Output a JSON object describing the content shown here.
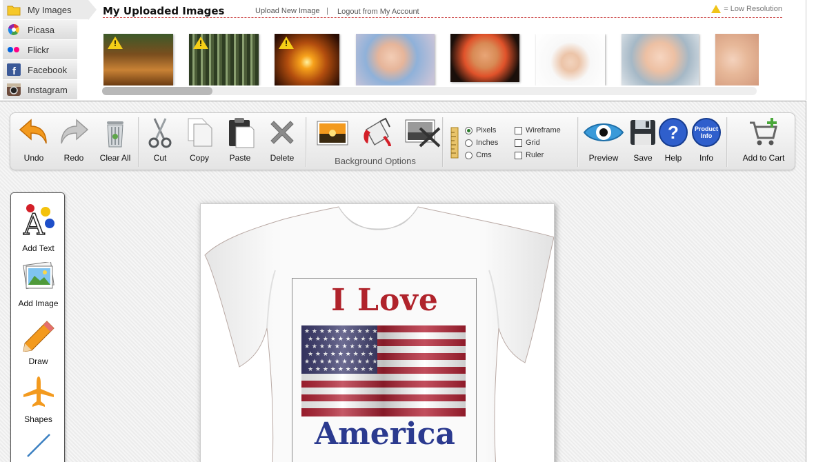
{
  "sources": [
    {
      "label": "My Images",
      "icon": "folder-icon",
      "active": true
    },
    {
      "label": "Picasa",
      "icon": "picasa-icon"
    },
    {
      "label": "Flickr",
      "icon": "flickr-icon"
    },
    {
      "label": "Facebook",
      "icon": "facebook-icon"
    },
    {
      "label": "Instagram",
      "icon": "instagram-icon"
    }
  ],
  "header": {
    "title": "My Uploaded Images",
    "upload_link": "Upload New Image",
    "separator": "|",
    "logout_link": "Logout from My Account",
    "low_res_legend": "= Low Resolution"
  },
  "thumbnails": [
    {
      "subject": "forest path",
      "low_res": true
    },
    {
      "subject": "bamboo path",
      "low_res": true
    },
    {
      "subject": "sunset pier",
      "low_res": true
    },
    {
      "subject": "laughing baby",
      "low_res": false
    },
    {
      "subject": "baby with glasses",
      "low_res": false
    },
    {
      "subject": "baby with flag",
      "low_res": false
    },
    {
      "subject": "smiling baby",
      "low_res": false
    },
    {
      "subject": "baby close-up",
      "low_res": false
    }
  ],
  "toolbar": {
    "undo": "Undo",
    "redo": "Redo",
    "clear_all": "Clear All",
    "cut": "Cut",
    "copy": "Copy",
    "paste": "Paste",
    "delete": "Delete",
    "background_options": "Background Options",
    "units": {
      "pixels": "Pixels",
      "inches": "Inches",
      "cms": "Cms",
      "selected": "Pixels"
    },
    "toggles": {
      "wireframe": "Wireframe",
      "grid": "Grid",
      "ruler": "Ruler"
    },
    "preview": "Preview",
    "save": "Save",
    "help": "Help",
    "info": "Info",
    "info_icon_text": "Product Info",
    "add_to_cart": "Add to Cart"
  },
  "tools": {
    "add_text": "Add Text",
    "add_image": "Add Image",
    "draw": "Draw",
    "shapes": "Shapes"
  },
  "design": {
    "line1": "I Love",
    "line2": "America"
  },
  "colors": {
    "line1": "#b0232b",
    "line2": "#2b3a8f",
    "accent_orange": "#f39a1e"
  }
}
